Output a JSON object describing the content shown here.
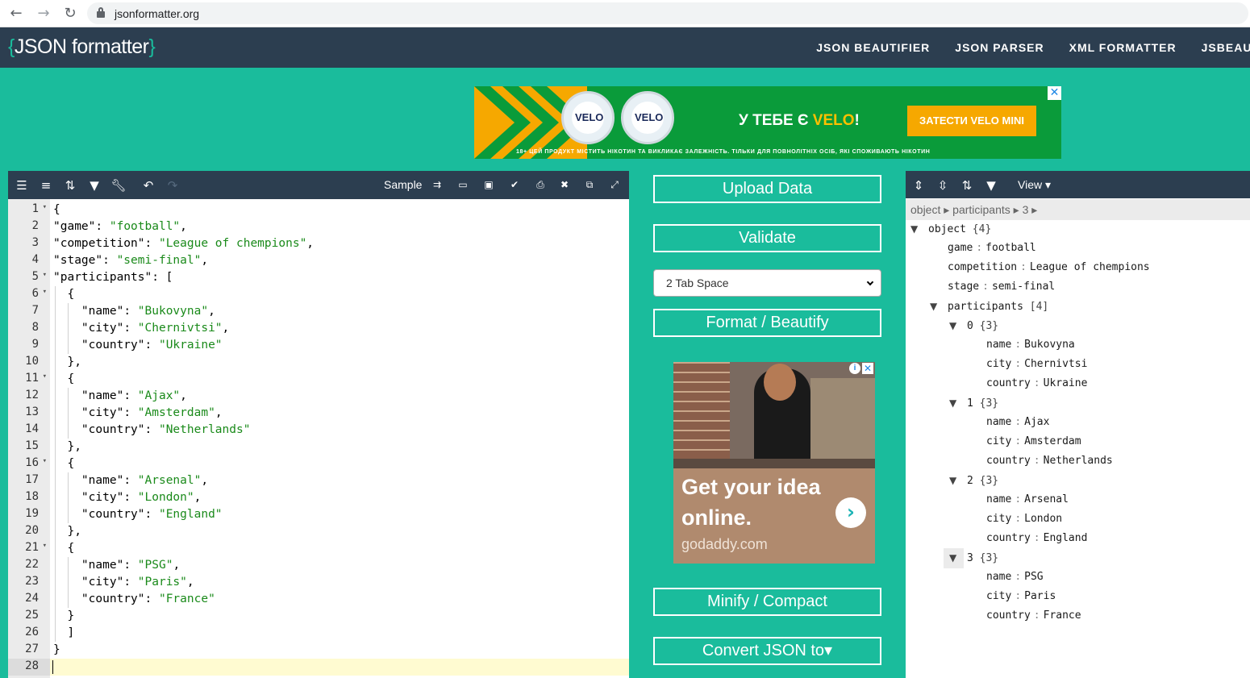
{
  "browser": {
    "url": "jsonformatter.org",
    "back_icon": "arrow-left-icon",
    "forward_icon": "arrow-right-icon",
    "reload_icon": "reload-icon"
  },
  "header": {
    "logo_open": "{",
    "logo_text": "JSON formatter",
    "logo_close": "}",
    "nav": [
      "JSON BEAUTIFIER",
      "JSON PARSER",
      "XML FORMATTER",
      "JSBEAUT"
    ]
  },
  "banner_ad": {
    "tin_label": "VELO",
    "headline_prefix": "У ТЕБЕ Є ",
    "headline_brand": "VELO",
    "headline_suffix": "!",
    "cta": "ЗАТЕСТИ VELO MINI",
    "fine_print": "18+ ЦЕЙ ПРОДУКТ МІСТИТЬ НІКОТИН ТА ВИКЛИКАЄ ЗАЛЕЖНІСТЬ. ТІЛЬКИ ДЛЯ ПОВНОЛІТНІХ ОСІБ, ЯКІ СПОЖИВАЮТЬ НІКОТИН",
    "close": "✕"
  },
  "editor": {
    "sample_label": "Sample",
    "line_numbers": [
      "1",
      "2",
      "3",
      "4",
      "5",
      "6",
      "7",
      "8",
      "9",
      "10",
      "11",
      "12",
      "13",
      "14",
      "15",
      "16",
      "17",
      "18",
      "19",
      "20",
      "21",
      "22",
      "23",
      "24",
      "25",
      "26",
      "27",
      "28"
    ],
    "lines": [
      {
        "indent": "",
        "parts": [
          {
            "t": "p",
            "v": "{"
          }
        ]
      },
      {
        "indent": "",
        "parts": [
          {
            "t": "k",
            "v": "\"game\""
          },
          {
            "t": "p",
            "v": ": "
          },
          {
            "t": "s",
            "v": "\"football\""
          },
          {
            "t": "p",
            "v": ","
          }
        ]
      },
      {
        "indent": "",
        "parts": [
          {
            "t": "k",
            "v": "\"competition\""
          },
          {
            "t": "p",
            "v": ": "
          },
          {
            "t": "s",
            "v": "\"League of chempions\""
          },
          {
            "t": "p",
            "v": ","
          }
        ]
      },
      {
        "indent": "",
        "parts": [
          {
            "t": "k",
            "v": "\"stage\""
          },
          {
            "t": "p",
            "v": ": "
          },
          {
            "t": "s",
            "v": "\"semi-final\""
          },
          {
            "t": "p",
            "v": ","
          }
        ]
      },
      {
        "indent": "",
        "parts": [
          {
            "t": "k",
            "v": "\"participants\""
          },
          {
            "t": "p",
            "v": ": ["
          }
        ]
      },
      {
        "indent": "  ",
        "parts": [
          {
            "t": "p",
            "v": "{"
          }
        ]
      },
      {
        "indent": "    ",
        "parts": [
          {
            "t": "k",
            "v": "\"name\""
          },
          {
            "t": "p",
            "v": ": "
          },
          {
            "t": "s",
            "v": "\"Bukovyna\""
          },
          {
            "t": "p",
            "v": ","
          }
        ]
      },
      {
        "indent": "    ",
        "parts": [
          {
            "t": "k",
            "v": "\"city\""
          },
          {
            "t": "p",
            "v": ": "
          },
          {
            "t": "s",
            "v": "\"Chernivtsi\""
          },
          {
            "t": "p",
            "v": ","
          }
        ]
      },
      {
        "indent": "    ",
        "parts": [
          {
            "t": "k",
            "v": "\"country\""
          },
          {
            "t": "p",
            "v": ": "
          },
          {
            "t": "s",
            "v": "\"Ukraine\""
          }
        ]
      },
      {
        "indent": "  ",
        "parts": [
          {
            "t": "p",
            "v": "},"
          }
        ]
      },
      {
        "indent": "  ",
        "parts": [
          {
            "t": "p",
            "v": "{"
          }
        ]
      },
      {
        "indent": "    ",
        "parts": [
          {
            "t": "k",
            "v": "\"name\""
          },
          {
            "t": "p",
            "v": ": "
          },
          {
            "t": "s",
            "v": "\"Ajax\""
          },
          {
            "t": "p",
            "v": ","
          }
        ]
      },
      {
        "indent": "    ",
        "parts": [
          {
            "t": "k",
            "v": "\"city\""
          },
          {
            "t": "p",
            "v": ": "
          },
          {
            "t": "s",
            "v": "\"Amsterdam\""
          },
          {
            "t": "p",
            "v": ","
          }
        ]
      },
      {
        "indent": "    ",
        "parts": [
          {
            "t": "k",
            "v": "\"country\""
          },
          {
            "t": "p",
            "v": ": "
          },
          {
            "t": "s",
            "v": "\"Netherlands\""
          }
        ]
      },
      {
        "indent": "  ",
        "parts": [
          {
            "t": "p",
            "v": "},"
          }
        ]
      },
      {
        "indent": "  ",
        "parts": [
          {
            "t": "p",
            "v": "{"
          }
        ]
      },
      {
        "indent": "    ",
        "parts": [
          {
            "t": "k",
            "v": "\"name\""
          },
          {
            "t": "p",
            "v": ": "
          },
          {
            "t": "s",
            "v": "\"Arsenal\""
          },
          {
            "t": "p",
            "v": ","
          }
        ]
      },
      {
        "indent": "    ",
        "parts": [
          {
            "t": "k",
            "v": "\"city\""
          },
          {
            "t": "p",
            "v": ": "
          },
          {
            "t": "s",
            "v": "\"London\""
          },
          {
            "t": "p",
            "v": ","
          }
        ]
      },
      {
        "indent": "    ",
        "parts": [
          {
            "t": "k",
            "v": "\"country\""
          },
          {
            "t": "p",
            "v": ": "
          },
          {
            "t": "s",
            "v": "\"England\""
          }
        ]
      },
      {
        "indent": "  ",
        "parts": [
          {
            "t": "p",
            "v": "},"
          }
        ]
      },
      {
        "indent": "  ",
        "parts": [
          {
            "t": "p",
            "v": "{"
          }
        ]
      },
      {
        "indent": "    ",
        "parts": [
          {
            "t": "k",
            "v": "\"name\""
          },
          {
            "t": "p",
            "v": ": "
          },
          {
            "t": "s",
            "v": "\"PSG\""
          },
          {
            "t": "p",
            "v": ","
          }
        ]
      },
      {
        "indent": "    ",
        "parts": [
          {
            "t": "k",
            "v": "\"city\""
          },
          {
            "t": "p",
            "v": ": "
          },
          {
            "t": "s",
            "v": "\"Paris\""
          },
          {
            "t": "p",
            "v": ","
          }
        ]
      },
      {
        "indent": "    ",
        "parts": [
          {
            "t": "k",
            "v": "\"country\""
          },
          {
            "t": "p",
            "v": ": "
          },
          {
            "t": "s",
            "v": "\"France\""
          }
        ]
      },
      {
        "indent": "  ",
        "parts": [
          {
            "t": "p",
            "v": "}"
          }
        ]
      },
      {
        "indent": "  ",
        "parts": [
          {
            "t": "p",
            "v": "]"
          }
        ]
      },
      {
        "indent": "",
        "parts": [
          {
            "t": "p",
            "v": "}"
          }
        ]
      },
      {
        "indent": "",
        "parts": []
      }
    ],
    "foldable_lines": [
      1,
      5,
      6,
      11,
      16,
      21
    ],
    "active_line": 28
  },
  "actions": {
    "upload": "Upload Data",
    "validate": "Validate",
    "indent_select": "2 Tab Space",
    "format": "Format / Beautify",
    "minify": "Minify / Compact",
    "convert": "Convert JSON to▾"
  },
  "side_ad": {
    "headline": "Get your idea online.",
    "domain": "godaddy.com",
    "arrow": "›",
    "info": "i",
    "close": "✕"
  },
  "tree": {
    "view_label": "View ▾",
    "breadcrumb": "object ▸ participants ▸ 3 ▸",
    "rows": [
      {
        "depth": 0,
        "toggle": "▼",
        "key": "object",
        "count": "{4}"
      },
      {
        "depth": 1,
        "key": "game",
        "value": "football"
      },
      {
        "depth": 1,
        "key": "competition",
        "value": "League of chempions"
      },
      {
        "depth": 1,
        "key": "stage",
        "value": "semi-final"
      },
      {
        "depth": 1,
        "toggle": "▼",
        "key": "participants",
        "count": "[4]"
      },
      {
        "depth": 2,
        "toggle": "▼",
        "key": "0",
        "count": "{3}"
      },
      {
        "depth": 3,
        "key": "name",
        "value": "Bukovyna"
      },
      {
        "depth": 3,
        "key": "city",
        "value": "Chernivtsi"
      },
      {
        "depth": 3,
        "key": "country",
        "value": "Ukraine"
      },
      {
        "depth": 2,
        "toggle": "▼",
        "key": "1",
        "count": "{3}"
      },
      {
        "depth": 3,
        "key": "name",
        "value": "Ajax"
      },
      {
        "depth": 3,
        "key": "city",
        "value": "Amsterdam"
      },
      {
        "depth": 3,
        "key": "country",
        "value": "Netherlands"
      },
      {
        "depth": 2,
        "toggle": "▼",
        "key": "2",
        "count": "{3}"
      },
      {
        "depth": 3,
        "key": "name",
        "value": "Arsenal"
      },
      {
        "depth": 3,
        "key": "city",
        "value": "London"
      },
      {
        "depth": 3,
        "key": "country",
        "value": "England"
      },
      {
        "depth": 2,
        "toggle": "▼",
        "key": "3",
        "count": "{3}"
      },
      {
        "depth": 3,
        "key": "name",
        "value": "PSG"
      },
      {
        "depth": 3,
        "key": "city",
        "value": "Paris"
      },
      {
        "depth": 3,
        "key": "country",
        "value": "France"
      }
    ]
  },
  "colors": {
    "page_bg": "#1abc9c",
    "header_bg": "#2c3e50",
    "string": "#1a8a1a",
    "active_line": "#fffbd1"
  }
}
